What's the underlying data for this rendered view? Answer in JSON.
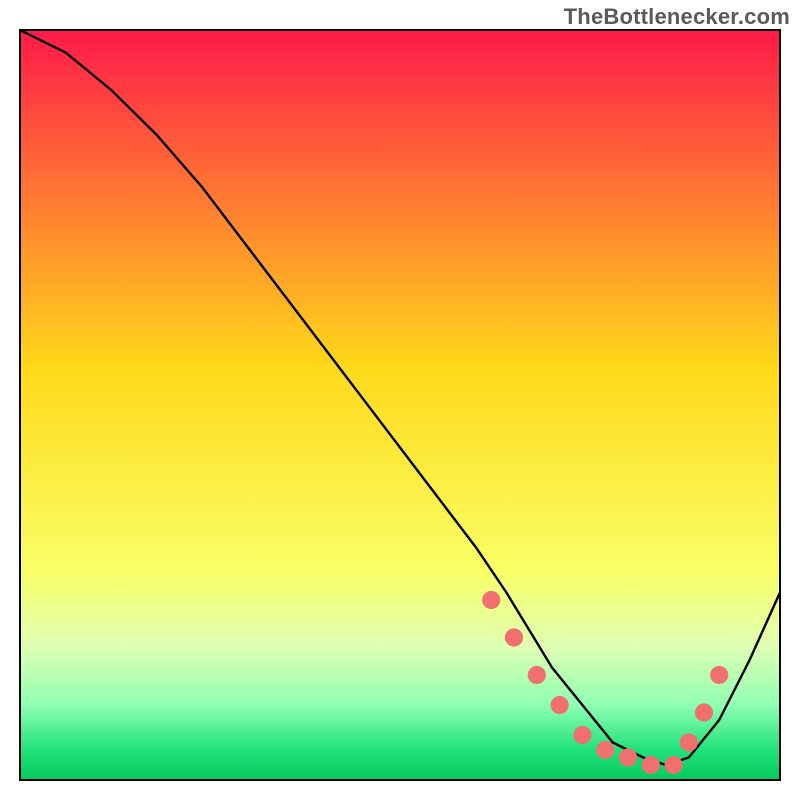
{
  "watermark": "TheBottlenecker.com",
  "chart_data": {
    "type": "line",
    "title": "",
    "xlabel": "",
    "ylabel": "",
    "xlim": [
      0,
      100
    ],
    "ylim": [
      0,
      100
    ],
    "background_gradient": {
      "stops": [
        {
          "y": 100,
          "color": "#ff1a4a"
        },
        {
          "y": 55,
          "color": "#ffd91a"
        },
        {
          "y": 28,
          "color": "#f9ff66"
        },
        {
          "y": 18,
          "color": "#e1ffb3"
        },
        {
          "y": 10,
          "color": "#8fffb3"
        },
        {
          "y": 4,
          "color": "#20e27a"
        },
        {
          "y": 0,
          "color": "#07c95f"
        }
      ],
      "note": "vertical gradient fill behind curve; y is percent of plot height from bottom"
    },
    "series": [
      {
        "name": "bottleneck-curve",
        "color": "#000000",
        "x": [
          0,
          6,
          12,
          18,
          24,
          30,
          36,
          42,
          48,
          54,
          60,
          64,
          67,
          70,
          74,
          78,
          82,
          85,
          88,
          92,
          96,
          100
        ],
        "y": [
          100,
          97,
          92,
          86,
          79,
          71,
          63,
          55,
          47,
          39,
          31,
          25,
          20,
          15,
          10,
          5,
          3,
          2,
          3,
          8,
          16,
          25
        ]
      }
    ],
    "markers": {
      "name": "highlighted-region",
      "color": "#f07070",
      "radius_plot_units": 1.2,
      "x": [
        62,
        65,
        68,
        71,
        74,
        77,
        80,
        83,
        86,
        88,
        90,
        92
      ],
      "y": [
        24,
        19,
        14,
        10,
        6,
        4,
        3,
        2,
        2,
        5,
        9,
        14
      ]
    }
  }
}
